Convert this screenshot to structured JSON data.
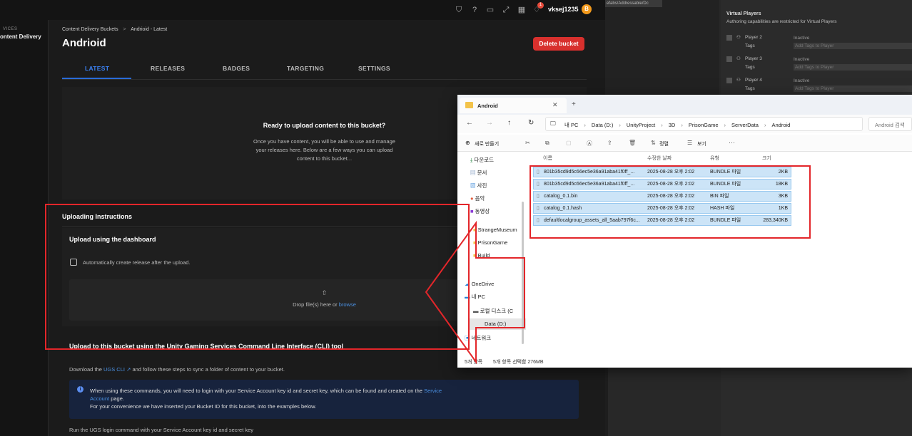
{
  "web": {
    "topbar": {
      "username": "vksej1235",
      "avatar_letter": "B",
      "notif_count": "1"
    },
    "sidebar": {
      "services": "VICES",
      "item": "ontent Delivery"
    },
    "breadcrumb": {
      "root": "Content Delivery Buckets",
      "sep": ">",
      "current": "Andrioid - Latest"
    },
    "page_title": "Andrioid",
    "delete_label": "Delete bucket",
    "tabs": [
      "LATEST",
      "RELEASES",
      "BADGES",
      "TARGETING",
      "SETTINGS"
    ],
    "empty": {
      "title": "Ready to upload content to this bucket?",
      "line1": "Once you have content, you will be able to use and manage",
      "line2": "your releases here. Below are a few ways you can upload",
      "line3": "content to this bucket..."
    },
    "uploading_title": "Uploading Instructions",
    "upload_dash_title": "Upload using the dashboard",
    "checkbox_label": "Automatically create release after the upload.",
    "drop_text": "Drop file(s) here or",
    "drop_link": "browse",
    "cli_title": "Upload to this bucket using the Unity Gaming Services Command Line Interface (CLI) tool",
    "download_pre": "Download the",
    "download_link": "UGS CLI",
    "download_post": "and follow these steps to sync a folder of content to your bucket.",
    "info_pre": "When using these commands, you will need to login with your Service Account key id and secret key, which can be found and created on the",
    "info_link1": "Service",
    "info_link2": "Account",
    "info_mid": "page.",
    "info_line2": "For your convenience we have inserted your Bucket ID for this bucket, into the examples below.",
    "run_text": "Run the UGS login command with your Service Account key id and secret key"
  },
  "explorer": {
    "tab_title": "Android",
    "breadcrumb": [
      "내 PC",
      "Data (D:)",
      "UnityProject",
      "3D",
      "PrisonGame",
      "ServerData",
      "Android"
    ],
    "search_placeholder": "Android 검색",
    "toolbar": {
      "new": "새로 만들기",
      "sort": "정렬",
      "view": "보기"
    },
    "columns": [
      "이름",
      "수정한 날짜",
      "유형",
      "크기"
    ],
    "nav": [
      "다운로드",
      "문서",
      "사진",
      "음악",
      "동영상",
      "StrangeMuseum",
      "PrisonGame",
      "Build",
      "OneDrive",
      "내 PC",
      "로컬 디스크 (C",
      "Data (D:)",
      "네트워크"
    ],
    "files": [
      {
        "name": "801b35cd9d5c66ec5e36a91aba41f0ff_...",
        "date": "2025-08-28 오후 2:02",
        "type": "BUNDLE 파일",
        "size": "2KB"
      },
      {
        "name": "801b35cd9d5c66ec5e36a91aba41f0ff_...",
        "date": "2025-08-28 오후 2:02",
        "type": "BUNDLE 파일",
        "size": "18KB"
      },
      {
        "name": "catalog_0.1.bin",
        "date": "2025-08-28 오후 2:02",
        "type": "BIN 파일",
        "size": "3KB"
      },
      {
        "name": "catalog_0.1.hash",
        "date": "2025-08-28 오후 2:02",
        "type": "HASH 파일",
        "size": "1KB"
      },
      {
        "name": "defaultlocalgroup_assets_all_5aab797f6c...",
        "date": "2025-08-28 오후 2:02",
        "type": "BUNDLE 파일",
        "size": "283,340KB"
      }
    ],
    "status_count": "5개 항목",
    "status_sel": "5개 항목 선택함 276MB"
  },
  "unity": {
    "path": "efabs/Addressable/Dc",
    "vp_title": "Virtual Players",
    "vp_sub": "Authoring capabilities are restricted for Virtual Players",
    "players": [
      {
        "name": "Player 2",
        "status": "Inactive",
        "tags": "Tags",
        "tag_ph": "Add Tags to Player"
      },
      {
        "name": "Player 3",
        "status": "Inactive",
        "tags": "Tags",
        "tag_ph": "Add Tags to Player"
      },
      {
        "name": "Player 4",
        "status": "Inactive",
        "tags": "Tags",
        "tag_ph": "Add Tags to Player"
      }
    ]
  }
}
